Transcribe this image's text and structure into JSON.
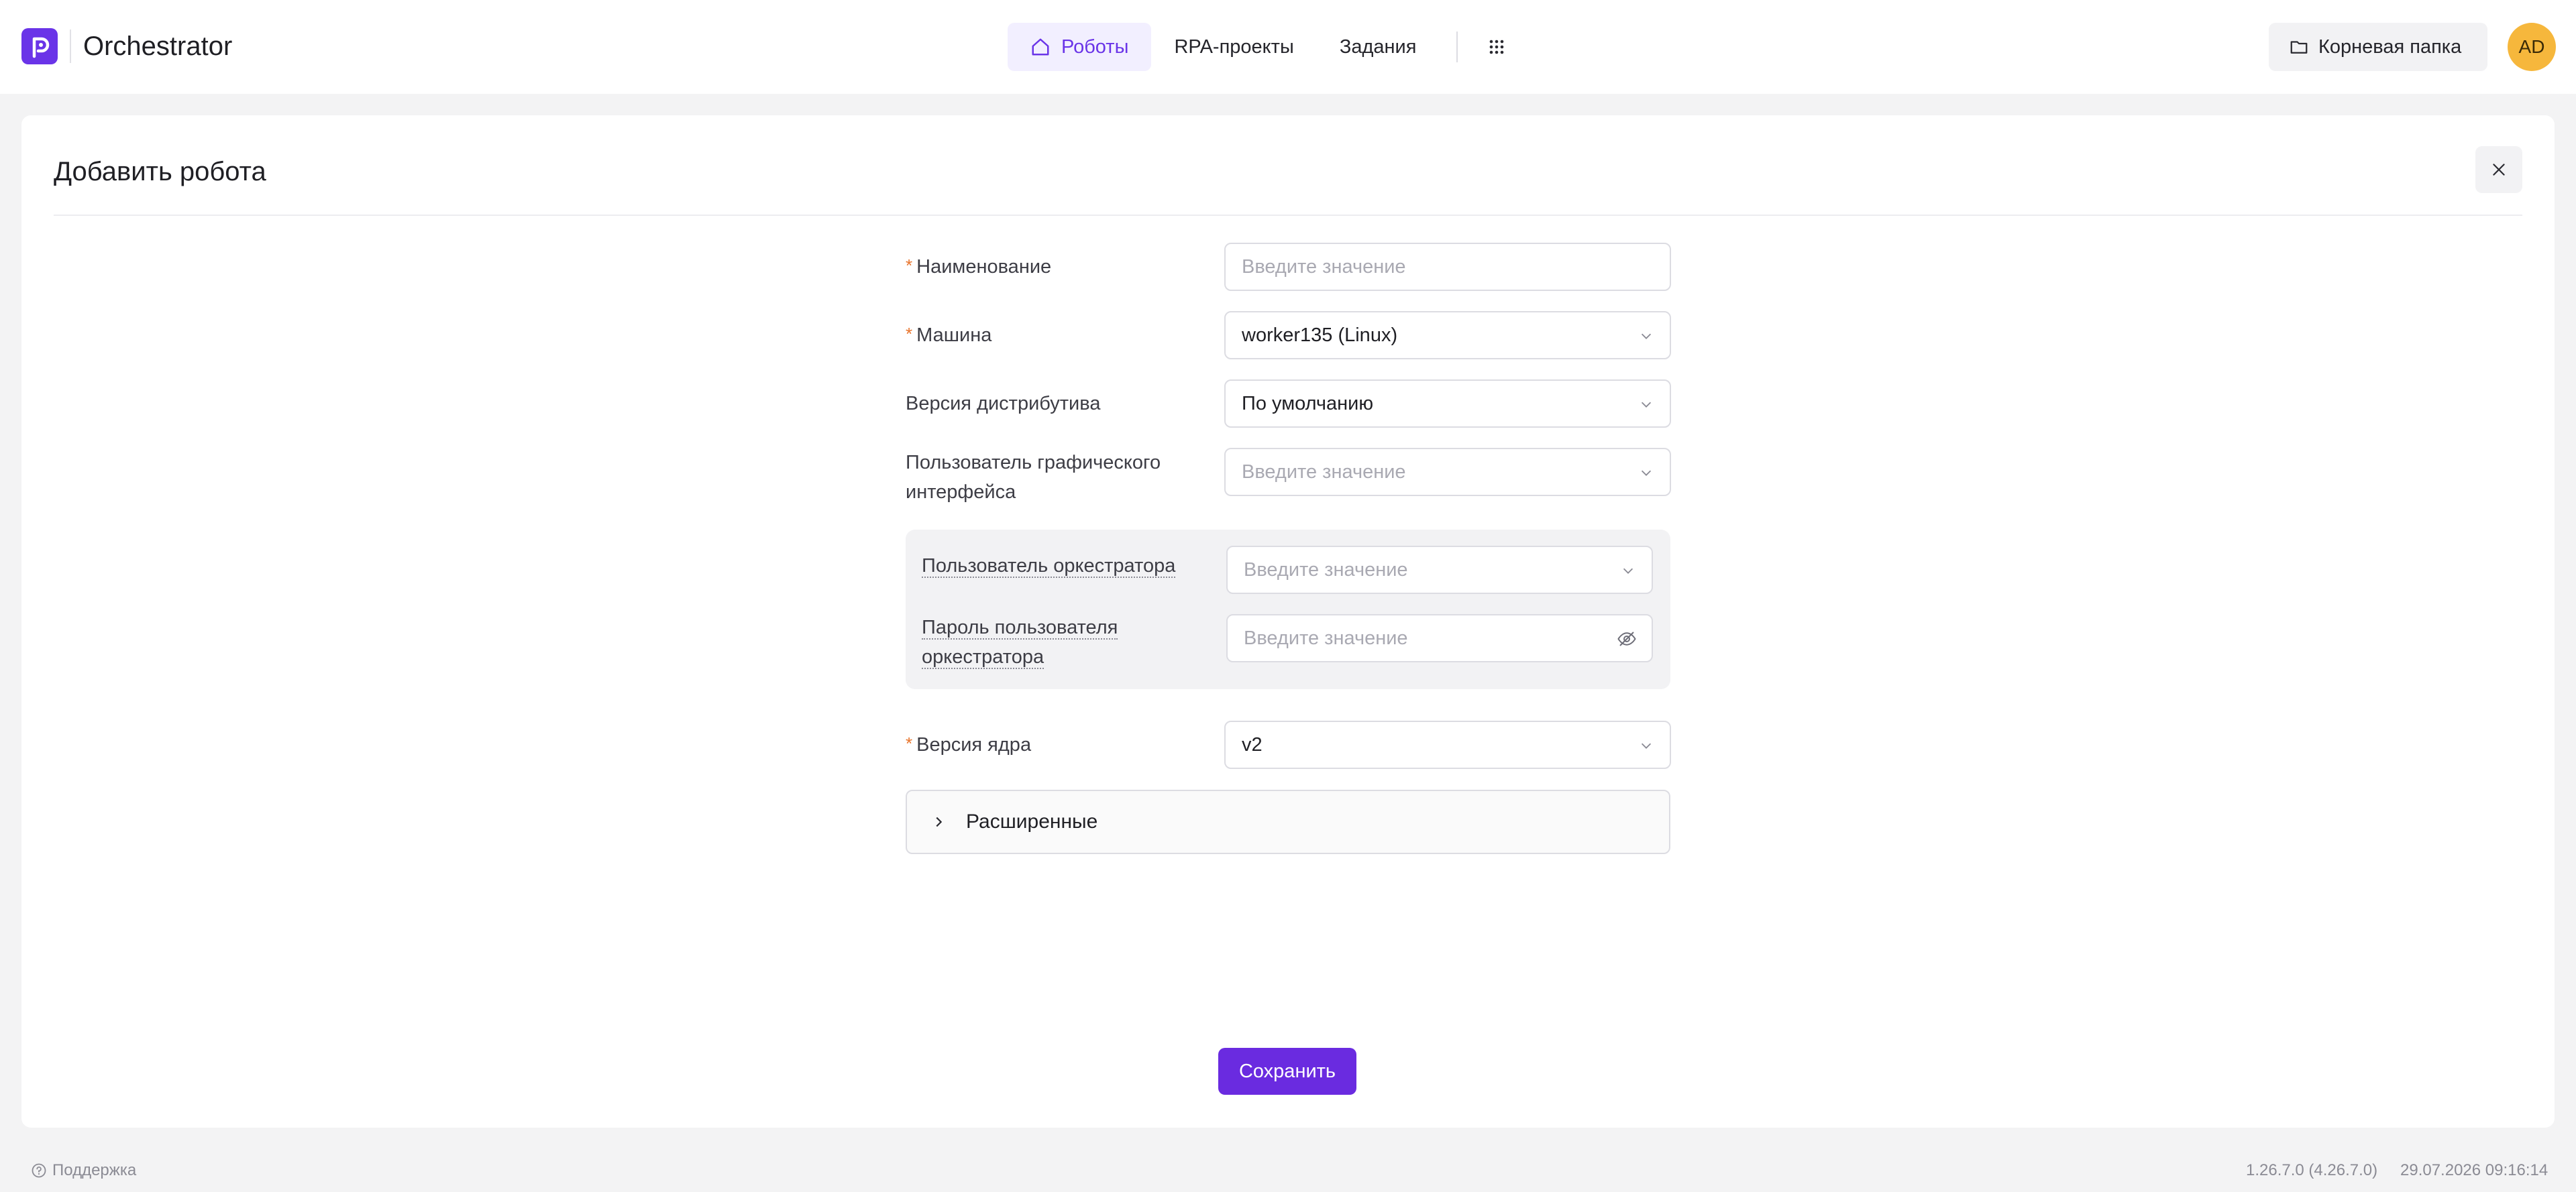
{
  "header": {
    "app_title": "Orchestrator",
    "nav": [
      {
        "label": "Роботы",
        "icon": "home-icon",
        "active": true
      },
      {
        "label": "RPA-проекты",
        "active": false
      },
      {
        "label": "Задания",
        "active": false
      }
    ],
    "apps_icon": "grid-icon",
    "folder_label": "Корневая папка",
    "avatar_initials": "AD"
  },
  "dialog": {
    "title": "Добавить робота",
    "fields": {
      "name": {
        "label": "Наименование",
        "required": true,
        "placeholder": "Введите значение",
        "value": ""
      },
      "machine": {
        "label": "Машина",
        "required": true,
        "value": "worker135 (Linux)"
      },
      "distro_version": {
        "label": "Версия дистрибутива",
        "required": false,
        "value": "По умолчанию"
      },
      "gui_user": {
        "label": "Пользователь графического интерфейса",
        "required": false,
        "placeholder": "Введите значение",
        "value": ""
      },
      "orch_user": {
        "label": "Пользователь оркестратора",
        "required": false,
        "placeholder": "Введите значение",
        "value": ""
      },
      "orch_password": {
        "label": "Пароль пользователя оркестратора",
        "required": false,
        "placeholder": "Введите значение",
        "value": ""
      },
      "kernel_version": {
        "label": "Версия ядра",
        "required": true,
        "value": "v2"
      }
    },
    "advanced_label": "Расширенные",
    "save_label": "Сохранить"
  },
  "footer": {
    "support_label": "Поддержка",
    "version": "1.26.7.0 (4.26.7.0)",
    "datetime": "29.07.2026 09:16:14"
  },
  "colors": {
    "accent": "#6a34e8",
    "required_mark": "#e8742c",
    "avatar_bg": "#f6b73c"
  }
}
